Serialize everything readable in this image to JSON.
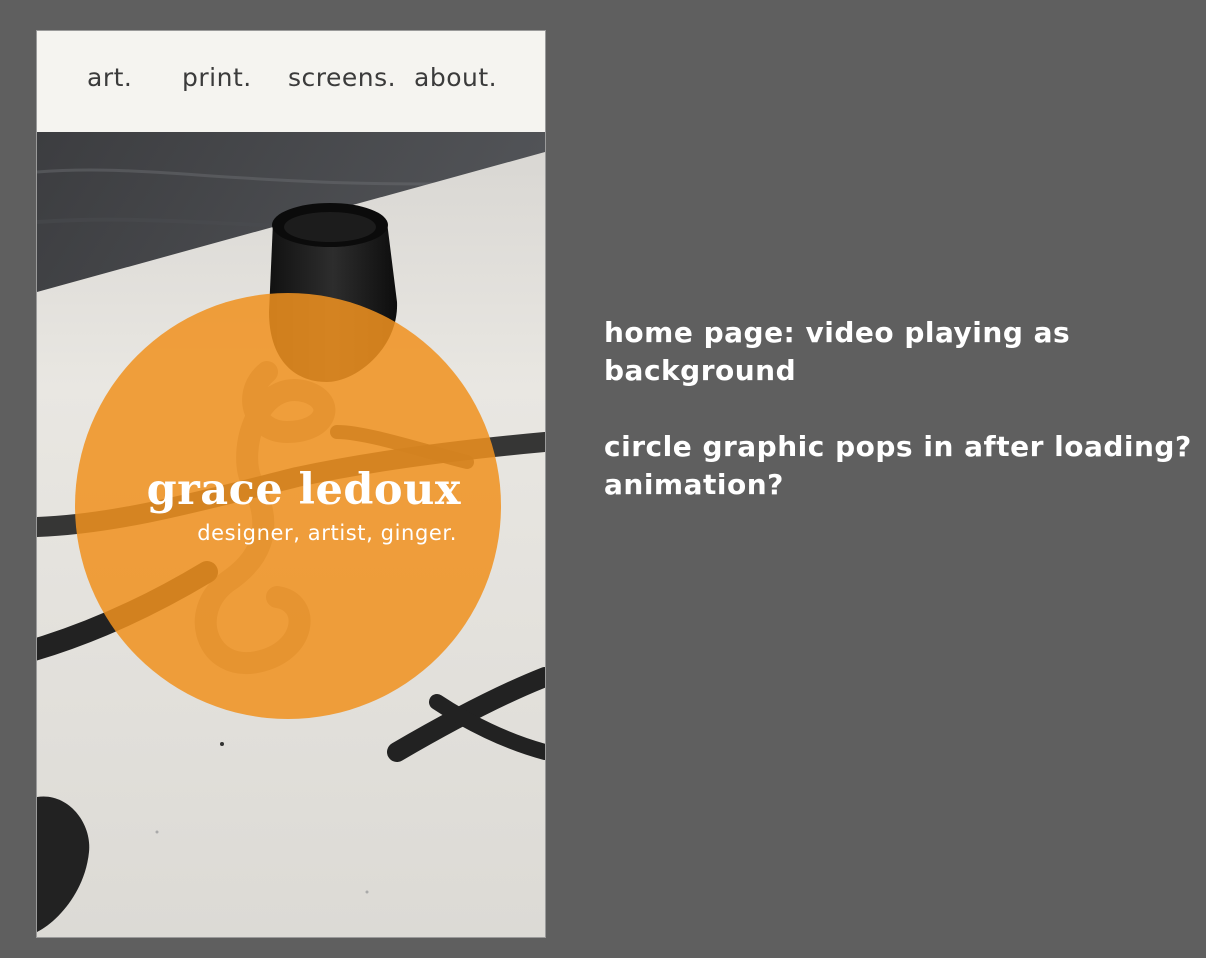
{
  "nav": {
    "items": [
      {
        "label": "art."
      },
      {
        "label": "print."
      },
      {
        "label": "screens."
      },
      {
        "label": "about."
      }
    ]
  },
  "hero": {
    "name": "grace ledoux",
    "tagline": "designer, artist, ginger.",
    "circle_color": "#f09220"
  },
  "notes": {
    "note1": {
      "line1": "home page: video playing as",
      "line2": "background"
    },
    "note2": {
      "line1": "circle graphic pops in after loading?",
      "line2": "animation?"
    }
  },
  "colors": {
    "background": "#5f5f5f",
    "nav_bg": "#f5f4f0",
    "nav_text": "#3b3b3b",
    "note_text": "#ffffff"
  }
}
